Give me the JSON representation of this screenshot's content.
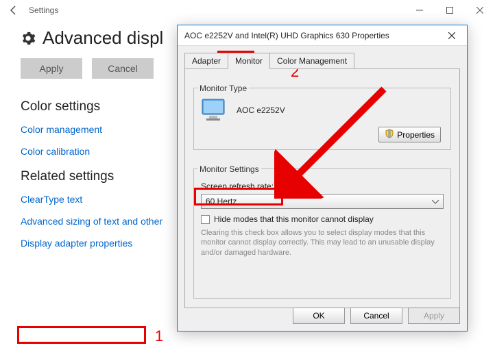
{
  "settings": {
    "window_title": "Settings",
    "page_title": "Advanced displ",
    "buttons": {
      "apply": "Apply",
      "cancel": "Cancel"
    },
    "sections": {
      "color_settings_h": "Color settings",
      "color_management": "Color management",
      "color_calibration": "Color calibration",
      "related_h": "Related settings",
      "cleartype": "ClearType text",
      "advanced_sizing": "Advanced sizing of text and other",
      "display_adapter": "Display adapter properties"
    }
  },
  "dialog": {
    "title": "AOC e2252V  and Intel(R) UHD Graphics 630 Properties",
    "tabs": {
      "adapter": "Adapter",
      "monitor": "Monitor",
      "color_mgmt": "Color Management"
    },
    "monitor_type_group": "Monitor Type",
    "monitor_name": "AOC e2252V",
    "properties_btn": "Properties",
    "monitor_settings_group": "Monitor Settings",
    "refresh_label": "Screen refresh rate:",
    "refresh_value": "60 Hertz",
    "hide_modes": "Hide modes that this monitor cannot display",
    "hint": "Clearing this check box allows you to select display modes that this monitor cannot display correctly. This may lead to an unusable display and/or damaged hardware.",
    "buttons": {
      "ok": "OK",
      "cancel": "Cancel",
      "apply": "Apply"
    }
  },
  "annotations": {
    "one": "1",
    "two": "2"
  }
}
